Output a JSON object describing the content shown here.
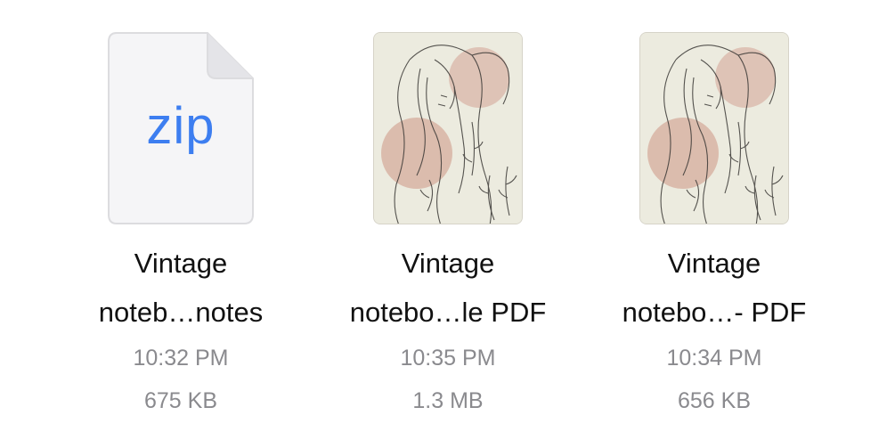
{
  "files": [
    {
      "name_line1": "Vintage",
      "name_line2": "noteb…notes",
      "time": "10:32 PM",
      "size": "675 KB",
      "icon": "zip-file-icon",
      "icon_label": "zip"
    },
    {
      "name_line1": "Vintage",
      "name_line2": "notebo…le PDF",
      "time": "10:35 PM",
      "size": "1.3 MB",
      "icon": "pdf-thumbnail"
    },
    {
      "name_line1": "Vintage",
      "name_line2": "notebo…- PDF",
      "time": "10:34 PM",
      "size": "656 KB",
      "icon": "pdf-thumbnail"
    }
  ],
  "colors": {
    "zip_label": "#3d7ef0",
    "meta_text": "#8a8a8e",
    "thumb_background": "#ecebdf",
    "thumb_accent": "#d9b7a8"
  }
}
